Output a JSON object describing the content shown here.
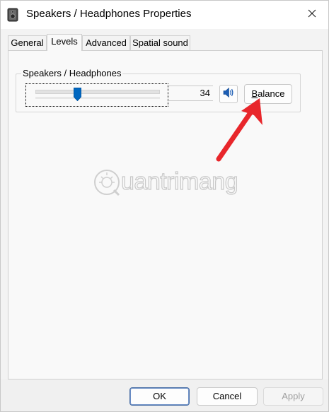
{
  "window": {
    "title": "Speakers / Headphones Properties"
  },
  "tabs": [
    {
      "label": "General"
    },
    {
      "label": "Levels",
      "active": true
    },
    {
      "label": "Advanced"
    },
    {
      "label": "Spatial sound"
    }
  ],
  "levels": {
    "group_label": "Speakers / Headphones",
    "volume_value": "34",
    "volume_fraction": 0.34,
    "balance_label_prefix": "B",
    "balance_label_rest": "alance"
  },
  "footer": {
    "ok_label": "OK",
    "cancel_label": "Cancel",
    "apply_label": "Apply"
  },
  "watermark": {
    "text": "uantrimang"
  },
  "colors": {
    "accent": "#0067c0",
    "annotation_arrow": "#e8262b"
  },
  "icons": {
    "title": "speaker-device-icon",
    "close": "close-icon",
    "mute_toggle": "speaker-volume-icon"
  }
}
